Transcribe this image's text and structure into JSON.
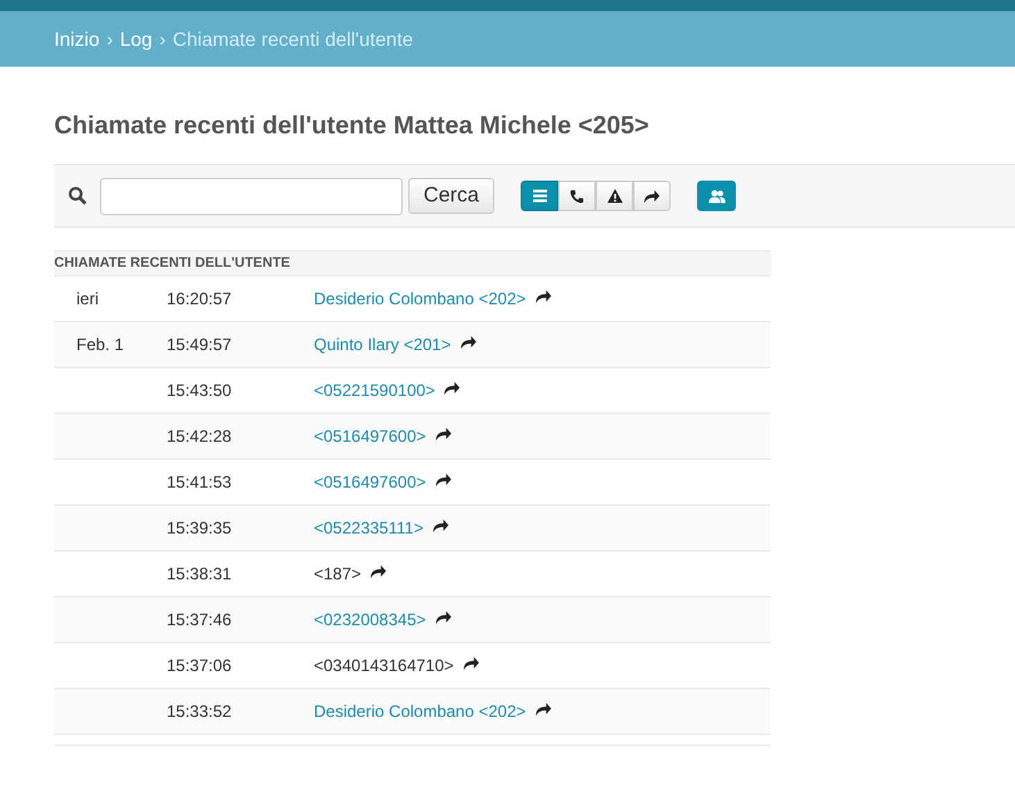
{
  "breadcrumb": [
    {
      "label": "Inizio",
      "current": false
    },
    {
      "label": "›",
      "kind": "sep"
    },
    {
      "label": "Log",
      "current": false
    },
    {
      "label": "›",
      "kind": "sep"
    },
    {
      "label": "Chiamate recenti dell'utente",
      "current": true
    }
  ],
  "title": "Chiamate recenti dell'utente Mattea Michele <205>",
  "search": {
    "button": "Cerca"
  },
  "filters": [
    {
      "kind": "list",
      "selected": true
    },
    {
      "kind": "phone",
      "selected": false
    },
    {
      "kind": "warning",
      "selected": false
    },
    {
      "kind": "forward",
      "selected": false
    }
  ],
  "table": {
    "heading": "CHIAMATE RECENTI DELL'UTENTE",
    "rows": [
      {
        "date": "ieri",
        "time": "16:20:57",
        "caller": "Desiderio Colombano <202>",
        "linked": true
      },
      {
        "date": "Feb. 1",
        "time": "15:49:57",
        "caller": "Quinto Ilary <201>",
        "linked": true
      },
      {
        "time": "15:43:50",
        "caller": "<05221590100>",
        "linked": true
      },
      {
        "time": "15:42:28",
        "caller": "<0516497600>",
        "linked": true
      },
      {
        "time": "15:41:53",
        "caller": "<0516497600>",
        "linked": true
      },
      {
        "time": "15:39:35",
        "caller": "<0522335111>",
        "linked": true
      },
      {
        "time": "15:38:31",
        "caller": "<187>",
        "linked": false
      },
      {
        "time": "15:37:46",
        "caller": "<0232008345>",
        "linked": true
      },
      {
        "time": "15:37:06",
        "caller": "<0340143164710>",
        "linked": false
      },
      {
        "time": "15:33:52",
        "caller": "Desiderio Colombano <202>",
        "linked": true
      }
    ]
  }
}
